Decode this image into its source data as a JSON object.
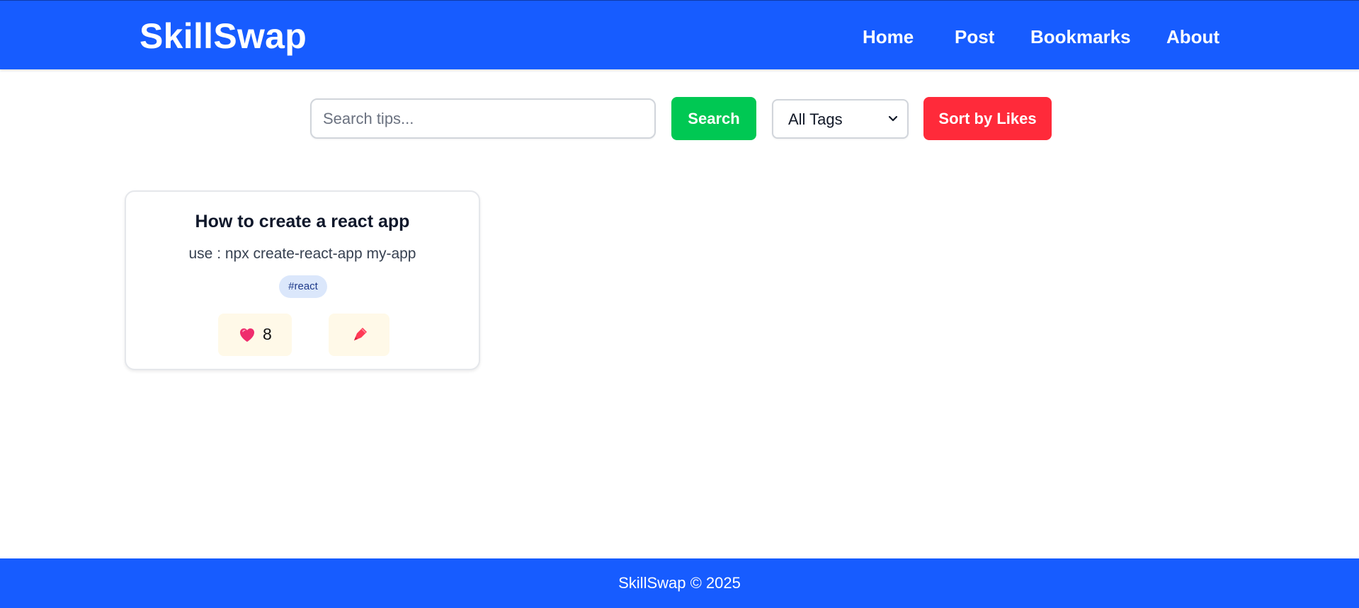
{
  "header": {
    "brand": "SkillSwap",
    "nav": [
      {
        "label": "Home"
      },
      {
        "label": "Post"
      },
      {
        "label": "Bookmarks"
      },
      {
        "label": "About"
      }
    ]
  },
  "search": {
    "placeholder": "Search tips...",
    "value": "",
    "button_label": "Search",
    "tag_filter": {
      "selected": "All Tags"
    },
    "sort_label": "Sort by Likes"
  },
  "tips": [
    {
      "title": "How to create a react app",
      "body": "use : npx create-react-app my-app",
      "tag": "#react",
      "likes": "8",
      "like_icon": "heart-icon",
      "bookmark_icon": "bookmark-icon"
    }
  ],
  "footer": {
    "text": "SkillSwap © 2025"
  },
  "colors": {
    "primary": "#175cff",
    "search_button": "#00c853",
    "sort_button": "#ff2a3a",
    "tag_background": "#dbe7fb",
    "action_background": "#fff9e8"
  }
}
